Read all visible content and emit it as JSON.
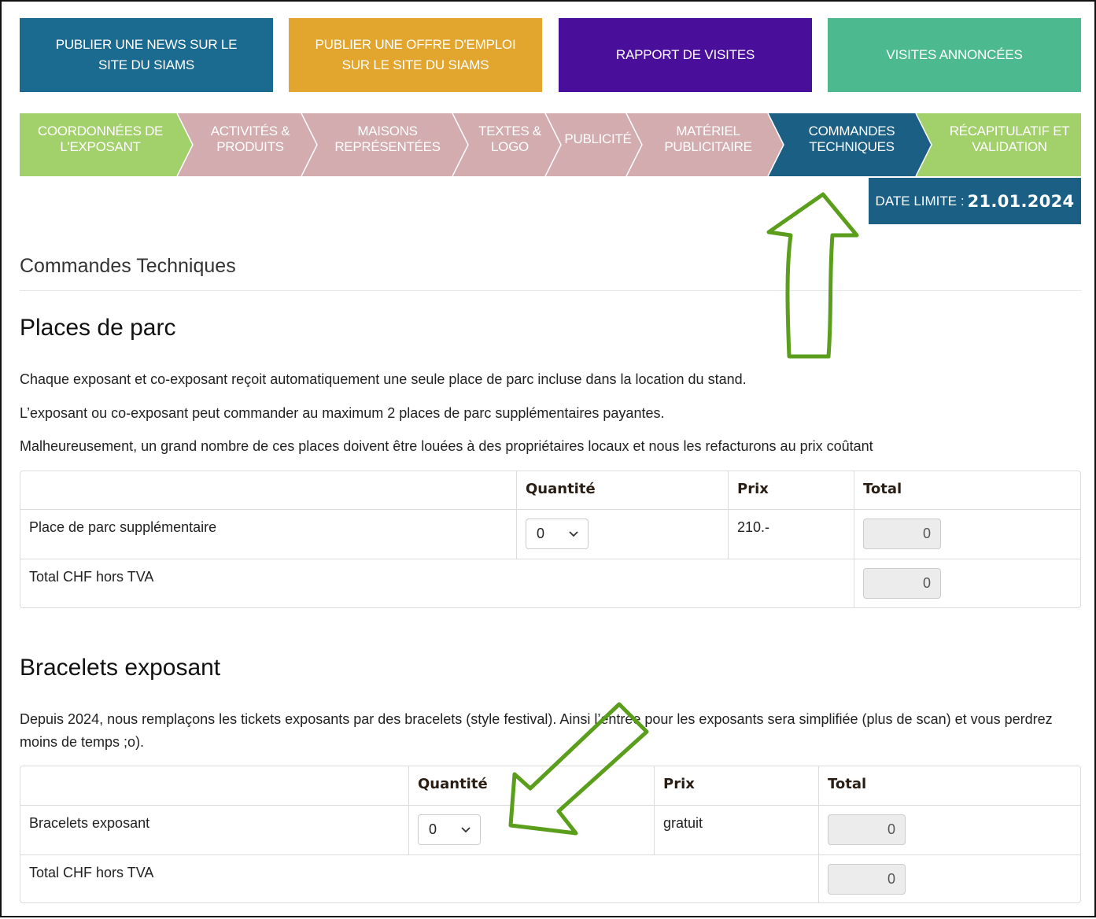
{
  "top_buttons": [
    {
      "label": "PUBLIER UNE NEWS SUR LE SITE DU SIAMS",
      "color": "#1b6a8f"
    },
    {
      "label": "PUBLIER UNE OFFRE D'EMPLOI SUR LE SITE DU SIAMS",
      "color": "#e2a52e"
    },
    {
      "label": "RAPPORT DE VISITES",
      "color": "#4a0f9a"
    },
    {
      "label": "VISITES ANNONCÉES",
      "color": "#4cba8e"
    }
  ],
  "steps": [
    {
      "label": "COORDONNÉES DE L'EXPOSANT",
      "state": "done"
    },
    {
      "label": "ACTIVITÉS & PRODUITS",
      "state": "pending"
    },
    {
      "label": "MAISONS REPRÉSENTÉES",
      "state": "pending"
    },
    {
      "label": "TEXTES & LOGO",
      "state": "pending"
    },
    {
      "label": "PUBLICITÉ",
      "state": "pending"
    },
    {
      "label": "MATÉRIEL PUBLICITAIRE",
      "state": "pending"
    },
    {
      "label": "COMMANDES TECHNIQUES",
      "state": "active"
    },
    {
      "label": "RÉCAPITULATIF ET VALIDATION",
      "state": "done"
    }
  ],
  "colors": {
    "step_done": "#a2d06a",
    "step_pending": "#d2acaf",
    "step_active": "#1b5f85",
    "annotation_arrow": "#5a9e1c"
  },
  "deadline": {
    "label": "DATE LIMITE :",
    "date": "21.01.2024"
  },
  "page_title": "Commandes Techniques",
  "parking": {
    "title": "Places de parc",
    "paragraphs": [
      "Chaque exposant et co-exposant reçoit automatiquement une seule place de parc incluse dans la location du stand.",
      "L’exposant ou co-exposant peut commander au maximum 2 places de parc supplémentaires payantes.",
      "Malheureusement, un grand nombre de ces places doivent être louées à des propriétaires locaux et nous les refacturons au prix coûtant"
    ],
    "headers": {
      "quantity": "Quantité",
      "price": "Prix",
      "total": "Total"
    },
    "row": {
      "label": "Place de parc supplémentaire",
      "quantity": "0",
      "price": "210.-",
      "total": "0"
    },
    "total_row": {
      "label": "Total CHF hors TVA",
      "total": "0"
    }
  },
  "bracelets": {
    "title": "Bracelets exposant",
    "paragraph": "Depuis 2024, nous remplaçons les tickets exposants par des bracelets (style festival). Ainsi l’entrée pour les exposants sera simplifiée (plus de scan) et vous perdrez moins de temps ;o).",
    "headers": {
      "quantity": "Quantité",
      "price": "Prix",
      "total": "Total"
    },
    "row": {
      "label": "Bracelets exposant",
      "quantity": "0",
      "price": "gratuit",
      "total": "0"
    },
    "total_row": {
      "label": "Total CHF hors TVA",
      "total": "0"
    }
  }
}
